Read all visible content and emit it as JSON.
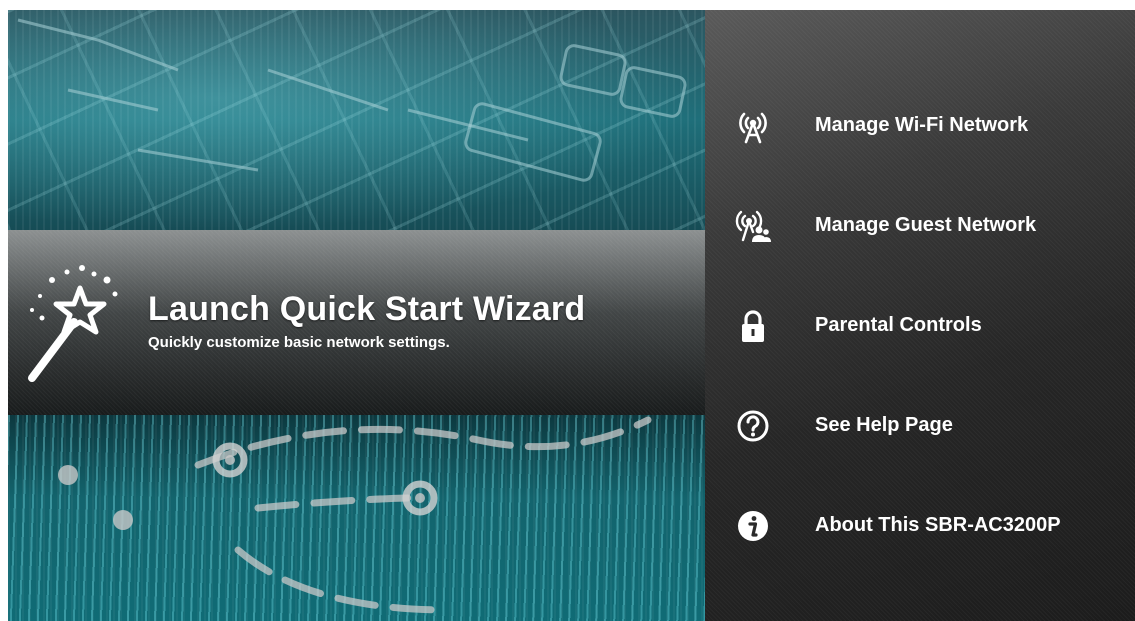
{
  "wizard": {
    "title": "Launch Quick Start Wizard",
    "subtitle": "Quickly customize basic network settings."
  },
  "menu": {
    "items": [
      {
        "label": "Manage Wi-Fi Network",
        "icon": "wifi-tower-icon"
      },
      {
        "label": "Manage Guest Network",
        "icon": "guest-network-icon"
      },
      {
        "label": "Parental Controls",
        "icon": "lock-icon"
      },
      {
        "label": "See Help Page",
        "icon": "help-icon"
      },
      {
        "label": "About This SBR-AC3200P",
        "icon": "info-icon"
      }
    ]
  },
  "colors": {
    "hero_teal": "#1f6f7a",
    "menu_dark": "#262626",
    "text": "#ffffff"
  }
}
